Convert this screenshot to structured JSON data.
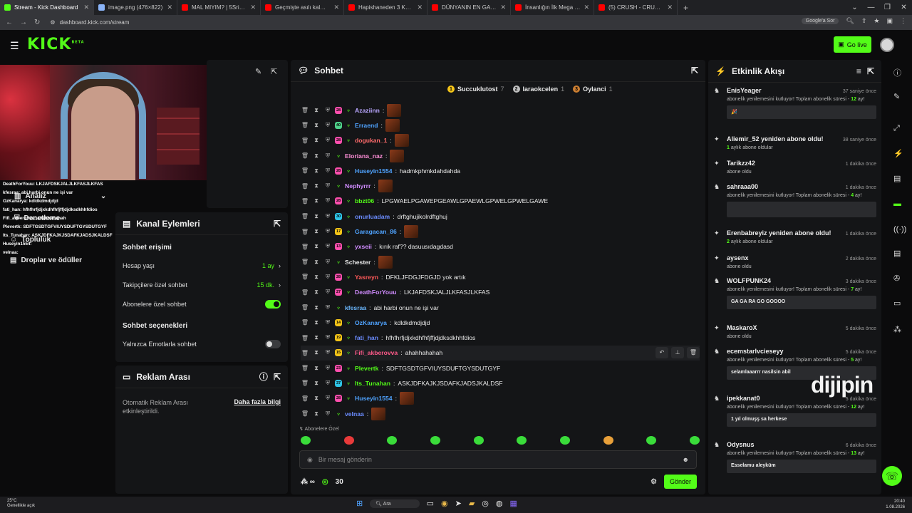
{
  "tabs": [
    {
      "label": "Stream - Kick Dashboard",
      "color": "#53fc18",
      "active": true
    },
    {
      "label": "image.png (476×822)",
      "color": "#8ab4f8"
    },
    {
      "label": "MAL MIYIM? | 5Sriders | Motor...",
      "color": "#ff0000"
    },
    {
      "label": "Geçmişte asılı kalmış ülke: Küba",
      "color": "#ff0000"
    },
    {
      "label": "Hapishaneden 3 Kez Kaçan Ada...",
      "color": "#ff0000"
    },
    {
      "label": "DÜNYANIN EN GARİP ADASINI...",
      "color": "#ff0000"
    },
    {
      "label": "İnsanlığın İlk Mega Projesi Göb...",
      "color": "#ff0000"
    },
    {
      "label": "(5) CRUSH - CRUSH | Official M...",
      "color": "#ff0000"
    }
  ],
  "url": "dashboard.kick.com/stream",
  "google_btn": "Google'a Sor",
  "logo": "KICK",
  "logo_beta": "BETA",
  "go_live": "Go live",
  "side_menu": [
    "Analiz",
    "Denetleme",
    "Topluluk",
    "Droplar ve ödüller"
  ],
  "overlay_chat": [
    "DeathForYouu: LKJAFDSKJALJLKFASJLKFAS",
    "kfesraa: abi harbi onun ne işi var",
    "OzKanarya: kdldkdmdjdjd",
    "fati_han: hfhfhrfjdjxkdhfhfjffjdjdksdkhhfdios",
    "Fifi_akberovva: ahahhahahah",
    "Plevertk: SDFTGSDTGFVIUYSDUFTGYSDUTGYF",
    "Its_Tunahan: ASKJDFKAJKJSDAFKJADSJKALDSF",
    "Huseyin1554:",
    "velnaa:"
  ],
  "kanal": {
    "title": "Kanal Eylemleri",
    "chat_access": "Sohbet erişimi",
    "account_age": "Hesap yaşı",
    "account_age_val": "1 ay",
    "followers_only": "Takipçilere özel sohbet",
    "followers_only_val": "15 dk.",
    "subs_only": "Abonelere özel sohbet",
    "chat_options": "Sohbet seçenekleri",
    "emotes_only": "Yalnızca Emotlarla sohbet"
  },
  "reklam": {
    "title": "Reklam Arası",
    "desc": "Otomatik Reklam Arası etkinleştirildi.",
    "more": "Daha fazla bilgi"
  },
  "chat": {
    "title": "Sohbet",
    "leaders": [
      {
        "rank": "1",
        "name": "Succuklutost",
        "count": "7",
        "color": "#f5c518"
      },
      {
        "rank": "2",
        "name": "laraokcelen",
        "count": "1",
        "color": "#c0c0c0"
      },
      {
        "rank": "3",
        "name": "Oylanci",
        "count": "1",
        "color": "#cd7f32"
      }
    ],
    "messages": [
      {
        "user": "Azaziinn",
        "color": "#b9a6ff",
        "text": "",
        "emote": true,
        "badges": [
          {
            "c": "#ff4fae",
            "t": "28"
          }
        ]
      },
      {
        "user": "Erraend",
        "color": "#4fa3ff",
        "text": "",
        "emote": true,
        "badges": [
          {
            "c": "#4fd18a",
            "t": "40"
          }
        ]
      },
      {
        "user": "dogukan_1",
        "color": "#ff6b6b",
        "text": "",
        "emote": true,
        "badges": [
          {
            "c": "#ff4fae",
            "t": "28"
          }
        ]
      },
      {
        "user": "Eloriana_naz",
        "color": "#ff8fd8",
        "text": "",
        "emote": true,
        "badges": []
      },
      {
        "user": "Huseyin1554",
        "color": "#4fa3ff",
        "text": "hadmkphmkdahdahda",
        "emote": false,
        "badges": [
          {
            "c": "#ff4fae",
            "t": "28"
          }
        ]
      },
      {
        "user": "Nephyrrr",
        "color": "#d08cff",
        "text": "",
        "emote": true,
        "badges": []
      },
      {
        "user": "bbzt06",
        "color": "#53fc18",
        "text": "LPGWAELPGAWEPGEAWLGPAEWLGPWELGPWELGAWE",
        "emote": false,
        "badges": [
          {
            "c": "#ff4fae",
            "t": "28"
          }
        ]
      },
      {
        "user": "onurluadam",
        "color": "#6b8cff",
        "text": "drftghujikolrdftghuj",
        "emote": false,
        "badges": [
          {
            "c": "#2ec4e6",
            "t": "30"
          }
        ]
      },
      {
        "user": "Garagacan_86",
        "color": "#4fa3ff",
        "text": "",
        "emote": true,
        "badges": [
          {
            "c": "#f5c518",
            "t": "17"
          }
        ]
      },
      {
        "user": "yxseii",
        "color": "#d08cff",
        "text": "kırık raf?? dasuusıdagdasd",
        "emote": false,
        "badges": [
          {
            "c": "#ff4fae",
            "t": "13"
          }
        ]
      },
      {
        "user": "Schester",
        "color": "#eaeaea",
        "text": "",
        "emote": true,
        "badges": []
      },
      {
        "user": "Yasreyn",
        "color": "#ff5a5a",
        "text": "DFKLJFDGJFDGJD yok artık",
        "emote": false,
        "badges": [
          {
            "c": "#ff4fae",
            "t": "28"
          }
        ]
      },
      {
        "user": "DeathForYouu",
        "color": "#d08cff",
        "text": "LKJAFDSKJALJLKFASJLKFAS",
        "emote": false,
        "badges": [
          {
            "c": "#ff4fae",
            "t": "27"
          }
        ]
      },
      {
        "user": "kfesraa",
        "color": "#6bb8ff",
        "text": "abi harbi onun ne işi var",
        "emote": false,
        "badges": []
      },
      {
        "user": "OzKanarya",
        "color": "#4fa3ff",
        "text": "kdldkdmdjdjd",
        "emote": false,
        "badges": [
          {
            "c": "#f5c518",
            "t": "14"
          }
        ]
      },
      {
        "user": "fati_han",
        "color": "#6b8cff",
        "text": "hfhfhrfjdjxkdhfhfjffjdjdksdkhhfdios",
        "emote": false,
        "badges": [
          {
            "c": "#f5c518",
            "t": "19"
          }
        ]
      },
      {
        "user": "Fifi_akberovva",
        "color": "#ff5a8a",
        "text": "ahahhahahah",
        "emote": false,
        "badges": [
          {
            "c": "#f5c518",
            "t": "15"
          }
        ],
        "hover": true
      },
      {
        "user": "Plevertk",
        "color": "#53fc18",
        "text": "SDFTGSDTGFVIUYSDUFTGYSDUTGYF",
        "emote": false,
        "badges": [
          {
            "c": "#ff4fae",
            "t": "23"
          }
        ]
      },
      {
        "user": "Its_Tunahan",
        "color": "#53fc18",
        "text": "ASKJDFKAJKJSDAFKJADSJKALDSF",
        "emote": false,
        "badges": [
          {
            "c": "#2ec4e6",
            "t": "37"
          }
        ]
      },
      {
        "user": "Huseyin1554",
        "color": "#4fa3ff",
        "text": "",
        "emote": true,
        "badges": [
          {
            "c": "#ff4fae",
            "t": "28"
          }
        ]
      },
      {
        "user": "velnaa",
        "color": "#6b8cff",
        "text": "",
        "emote": true,
        "badges": []
      }
    ],
    "subs_label": "Abonelere Özel",
    "placeholder": "Bir mesaj gönderin",
    "points": "30",
    "send": "Gönder"
  },
  "activity": {
    "title": "Etkinlik Akışı",
    "events": [
      {
        "name": "EnisYeager",
        "time": "37 saniye önce",
        "sub_pre": "abonelik yenilemesini kutluyor! Toplam abonelik süresi - ",
        "months": "12",
        "sub_post": " ay!",
        "box": "🎉"
      },
      {
        "name": "Aliemir_52 yeniden abone oldu!",
        "time": "38 saniye önce",
        "sub_pre": "",
        "months": "1",
        "sub_post": " aylık abone oldular",
        "box": ""
      },
      {
        "name": "Tarikzz42",
        "time": "1 dakika önce",
        "sub_pre": "abone oldu",
        "months": "",
        "sub_post": "",
        "box": ""
      },
      {
        "name": "sahraaa00",
        "time": "1 dakika önce",
        "sub_pre": "abonelik yenilemesini kutluyor! Toplam abonelik süresi - ",
        "months": "4",
        "sub_post": " ay!",
        "box": " "
      },
      {
        "name": "Erenbabreyiz yeniden abone oldu!",
        "time": "1 dakika önce",
        "sub_pre": "",
        "months": "2",
        "sub_post": " aylık abone oldular",
        "box": ""
      },
      {
        "name": "aysenx",
        "time": "2 dakika önce",
        "sub_pre": "abone oldu",
        "months": "",
        "sub_post": "",
        "box": ""
      },
      {
        "name": "WOLFPUNK24",
        "time": "3 dakika önce",
        "sub_pre": "abonelik yenilemesini kutluyor! Toplam abonelik süresi - ",
        "months": "7",
        "sub_post": " ay!",
        "box": "GA GA RA GO GOOOO"
      },
      {
        "name": "MaskaroX",
        "time": "5 dakika önce",
        "sub_pre": "abone oldu",
        "months": "",
        "sub_post": "",
        "box": ""
      },
      {
        "name": "ecemstarlvcieseyy",
        "time": "5 dakika önce",
        "sub_pre": "abonelik yenilemesini kutluyor! Toplam abonelik süresi - ",
        "months": "5",
        "sub_post": " ay!",
        "box": "selamlaaarrr nasilsin abil"
      },
      {
        "name": "ipekkanat0",
        "time": "5 dakika önce",
        "sub_pre": "abonelik yenilemesini kutluyor! Toplam abonelik süresi - ",
        "months": "12",
        "sub_post": " ay!",
        "box": "1 yıl olmuşş sa herkese"
      },
      {
        "name": "Odysnus",
        "time": "6 dakika önce",
        "sub_pre": "abonelik yenilemesini kutluyor! Toplam abonelik süresi - ",
        "months": "13",
        "sub_post": " ay!",
        "box": "Esselamu aleyküm"
      }
    ]
  },
  "watermark": "dijipin",
  "taskbar": {
    "temp": "25°C",
    "weather": "Genellikle açık",
    "search": "Ara",
    "time": "20:40",
    "date": "1.08.2026"
  }
}
